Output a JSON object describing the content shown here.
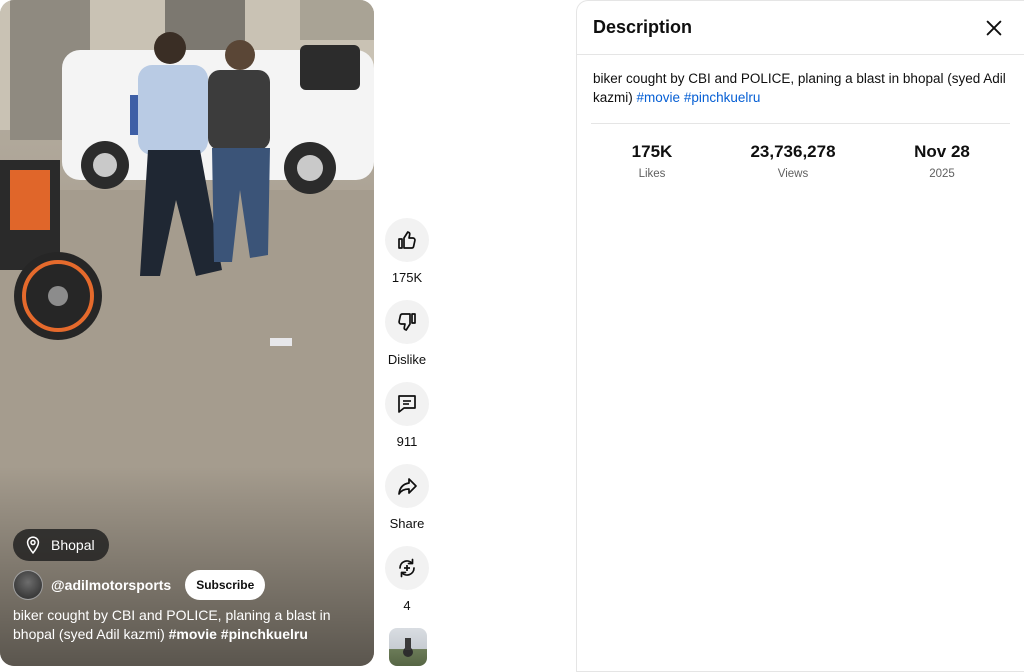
{
  "video": {
    "location": "Bhopal",
    "channel": "@adilmotorsports",
    "subscribe_label": "Subscribe",
    "caption_text": "biker cought by CBI and POLICE, planing a blast in bhopal (syed Adil kazmi)",
    "hashtags": [
      "#movie",
      "#pinchkuelru"
    ]
  },
  "actions": [
    {
      "label": "175K",
      "icon": "thumbs-up-icon"
    },
    {
      "label": "Dislike",
      "icon": "thumbs-down-icon"
    },
    {
      "label": "911",
      "icon": "comment-icon"
    },
    {
      "label": "Share",
      "icon": "share-icon"
    },
    {
      "label": "4",
      "icon": "remix-icon"
    }
  ],
  "panel": {
    "title": "Description",
    "description_text": "biker cought by CBI and POLICE, planing a blast in bhopal (syed Adil kazmi)",
    "hashtags": [
      "#movie",
      "#pinchkuelru"
    ],
    "stats": [
      {
        "value": "175K",
        "label": "Likes"
      },
      {
        "value": "23,736,278",
        "label": "Views"
      },
      {
        "value": "Nov 28",
        "label": "2025"
      }
    ]
  },
  "colors": {
    "link": "#065fd4",
    "chip_bg": "#1e1e1e",
    "action_bg": "#f2f2f2"
  }
}
